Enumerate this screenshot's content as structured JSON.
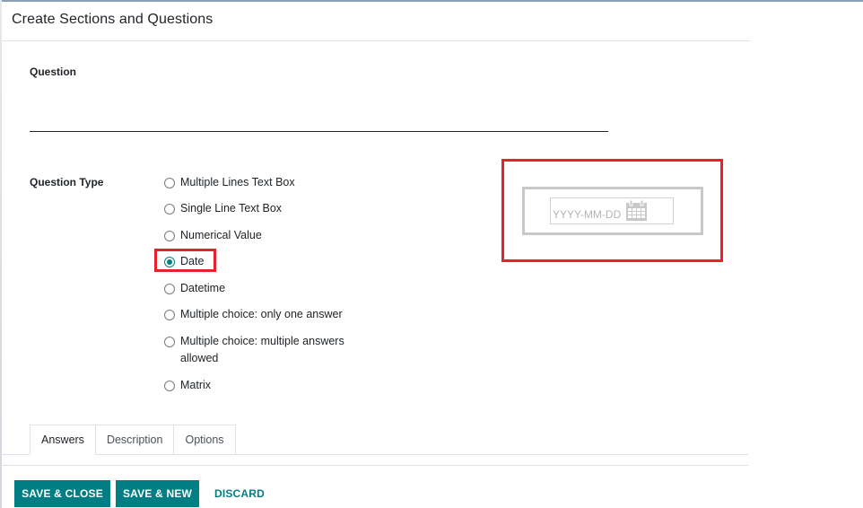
{
  "dialog": {
    "title": "Create Sections and Questions"
  },
  "form": {
    "question_label": "Question",
    "question_value": "",
    "question_type_label": "Question Type",
    "question_types": [
      {
        "label": "Multiple Lines Text Box",
        "checked": false
      },
      {
        "label": "Single Line Text Box",
        "checked": false
      },
      {
        "label": "Numerical Value",
        "checked": false
      },
      {
        "label": "Date",
        "checked": true
      },
      {
        "label": "Datetime",
        "checked": false
      },
      {
        "label": "Multiple choice: only one answer",
        "checked": false
      },
      {
        "label": "Multiple choice: multiple answers allowed",
        "checked": false
      },
      {
        "label": "Matrix",
        "checked": false
      }
    ]
  },
  "preview": {
    "date_placeholder": "YYYY-MM-DD",
    "icon": "calendar-icon"
  },
  "tabs": [
    {
      "label": "Answers",
      "active": true
    },
    {
      "label": "Description",
      "active": false
    },
    {
      "label": "Options",
      "active": false
    }
  ],
  "footer": {
    "save_close_label": "SAVE & CLOSE",
    "save_new_label": "SAVE & NEW",
    "discard_label": "DISCARD"
  },
  "colors": {
    "primary": "#017e84",
    "highlight": "#e8212b"
  }
}
